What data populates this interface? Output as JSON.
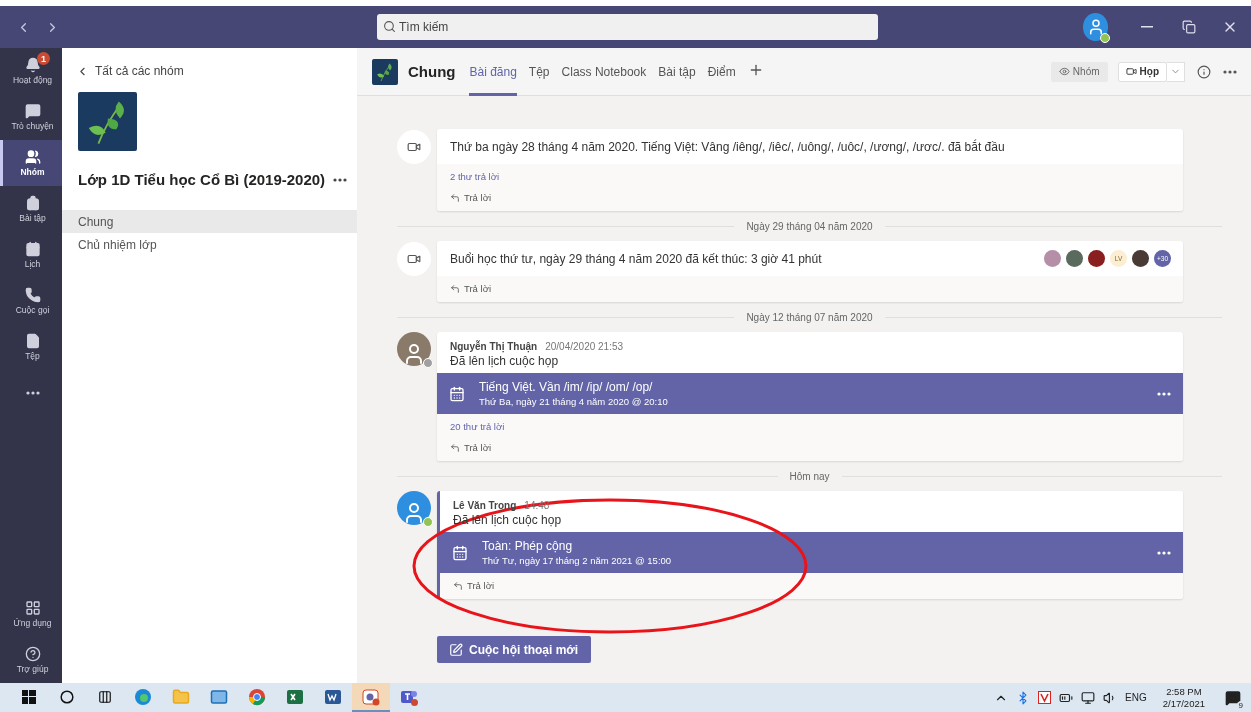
{
  "title_bar": {
    "search": {
      "placeholder": "Tìm kiếm"
    }
  },
  "rail": {
    "items": [
      {
        "label": "Hoạt động",
        "selected": false,
        "badge": "1"
      },
      {
        "label": "Trò chuyện",
        "selected": false
      },
      {
        "label": "Nhóm",
        "selected": true
      },
      {
        "label": "Bài tập",
        "selected": false
      },
      {
        "label": "Lịch",
        "selected": false
      },
      {
        "label": "Cuộc gọi",
        "selected": false
      },
      {
        "label": "Tệp",
        "selected": false
      }
    ],
    "bottom_items": [
      {
        "label": "Ứng dụng"
      },
      {
        "label": "Trợ giúp"
      }
    ]
  },
  "team_panel": {
    "back_link": "Tất cả các nhóm",
    "team_name": "Lớp 1D Tiểu học Cổ Bì (2019-2020)",
    "channels": [
      {
        "label": "Chung",
        "selected": true
      },
      {
        "label": "Chủ nhiệm lớp",
        "selected": false
      }
    ]
  },
  "channel_header": {
    "channel_name": "Chung",
    "tabs": [
      {
        "label": "Bài đăng",
        "selected": true
      },
      {
        "label": "Tệp",
        "selected": false
      },
      {
        "label": "Class Notebook",
        "selected": false
      },
      {
        "label": "Bài tập",
        "selected": false
      },
      {
        "label": "Điểm",
        "selected": false
      }
    ],
    "team_button": "Nhóm",
    "meet_button": "Họp"
  },
  "feed": [
    {
      "kind": "meeting",
      "text": "Thứ ba ngày 28 tháng 4 năm 2020. Tiếng Việt: Vâng /iêng/, /iêc/, /uông/, /uôc/, /ương/, /ươc/. đã bắt đầu",
      "replies_link": "2 thư trả lời",
      "reply": "Trả lời"
    },
    {
      "kind": "divider",
      "text": "Ngày 29 tháng 04 năm 2020"
    },
    {
      "kind": "meeting",
      "text": "Buổi học thứ tư, ngày 29 tháng 4 năm 2020 đã kết thúc: 3 giờ 41 phút",
      "participants": [
        {
          "kind": "photo",
          "color": "#b58fa8"
        },
        {
          "kind": "photo",
          "color": "#5a6b5e"
        },
        {
          "kind": "photo",
          "color": "#8a1f1f"
        },
        {
          "kind": "initials",
          "text": "LV",
          "color": "#fbeed3"
        },
        {
          "kind": "photo",
          "color": "#4a3a36"
        },
        {
          "kind": "more",
          "text": "+30",
          "color": "#6264a7"
        }
      ],
      "reply": "Trả lời"
    },
    {
      "kind": "divider",
      "text": "Ngày 12 tháng 07 năm 2020"
    },
    {
      "kind": "post",
      "author": "Nguyễn Thị Thuận",
      "time": "20/04/2020 21:53",
      "color": "#a0a0a0",
      "highlighted": false,
      "text": "Đã lên lịch cuộc họp",
      "event": {
        "title": "Tiếng Việt. Vần /im/ /ip/ /om/ /op/",
        "when": "Thứ Ba, ngày 21 tháng 4 năm 2020 @ 20:10"
      },
      "replies_link": "20 thư trả lời",
      "reply": "Trả lời"
    },
    {
      "kind": "divider",
      "text": "Hôm nay"
    },
    {
      "kind": "post",
      "author": "Lê Văn Trọng",
      "time": "14:48",
      "color": "#92c353",
      "highlighted": true,
      "text": "Đã lên lịch cuộc họp",
      "event": {
        "title": "Toàn: Phép cộng",
        "when": "Thứ Tư, ngày 17 tháng 2 năm 2021 @ 15:00"
      },
      "reply": "Trả lời"
    }
  ],
  "compose_button": "Cuộc hội thoại mới",
  "taskbar": {
    "apps": [
      {
        "kind": "edge",
        "active": false
      },
      {
        "kind": "folder",
        "active": false
      },
      {
        "kind": "mail",
        "active": false
      },
      {
        "kind": "chrome",
        "active": false
      },
      {
        "kind": "excel",
        "active": false
      },
      {
        "kind": "word",
        "active": false
      },
      {
        "kind": "meeting",
        "active": true
      },
      {
        "kind": "teams",
        "active": false
      }
    ],
    "language": "ENG",
    "time": "2:58 PM",
    "date": "2/17/2021",
    "notifications": "9"
  }
}
